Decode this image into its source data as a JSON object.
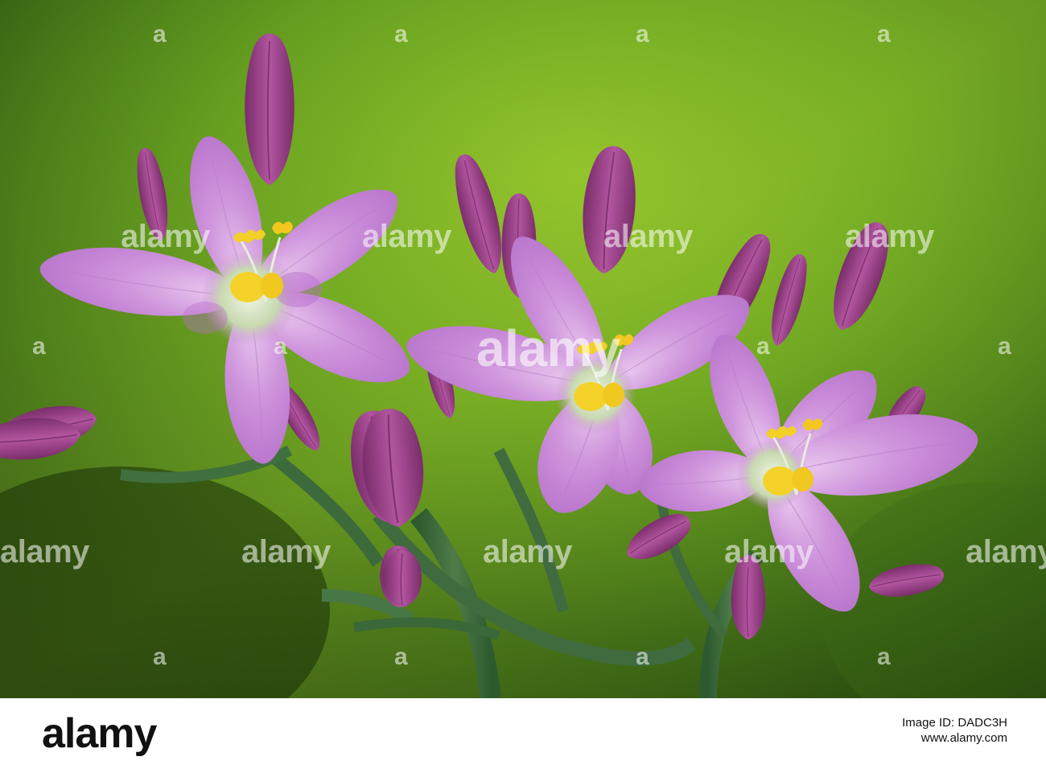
{
  "watermark": {
    "text": "alamy",
    "mark": "a",
    "brand_large": "alamy"
  },
  "footer": {
    "brand": "alamy",
    "image_id_label": "Image ID: DADC3H",
    "url": "www.alamy.com"
  },
  "colors": {
    "background_green": "#5f9a1e",
    "background_dark": "#1f3a0c",
    "petal": "#c98ad6",
    "bud": "#9c3f86",
    "anther": "#f2d028"
  }
}
